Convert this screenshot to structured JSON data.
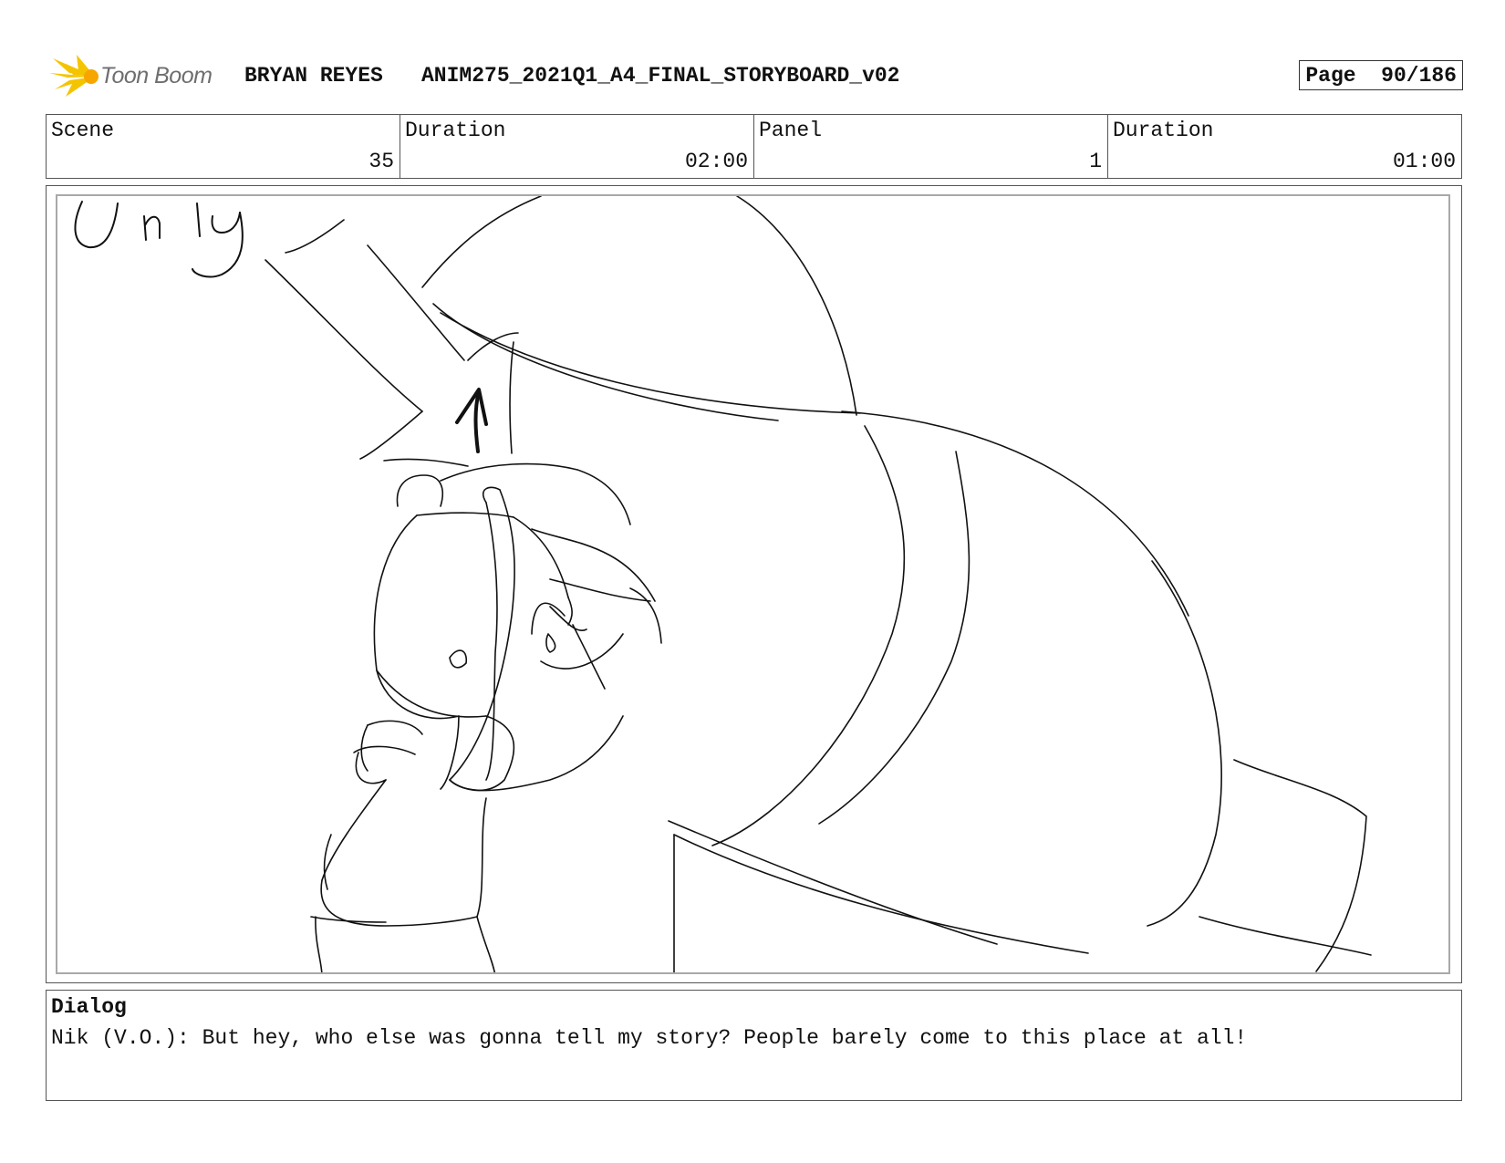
{
  "header": {
    "logo_text": "Toon Boom",
    "author": "BRYAN REYES",
    "project": "ANIM275_2021Q1_A4_FINAL_STORYBOARD_v02",
    "page_label": "Page",
    "page_value": "90/186"
  },
  "meta": {
    "scene_label": "Scene",
    "scene_value": "35",
    "scene_duration_label": "Duration",
    "scene_duration_value": "02:00",
    "panel_label": "Panel",
    "panel_value": "1",
    "panel_duration_label": "Duration",
    "panel_duration_value": "01:00"
  },
  "sketch": {
    "handwritten_text": "Unly"
  },
  "dialog": {
    "label": "Dialog",
    "text": "Nik (V.O.): But hey, who else was gonna tell my story? People barely come to this place at all!"
  }
}
